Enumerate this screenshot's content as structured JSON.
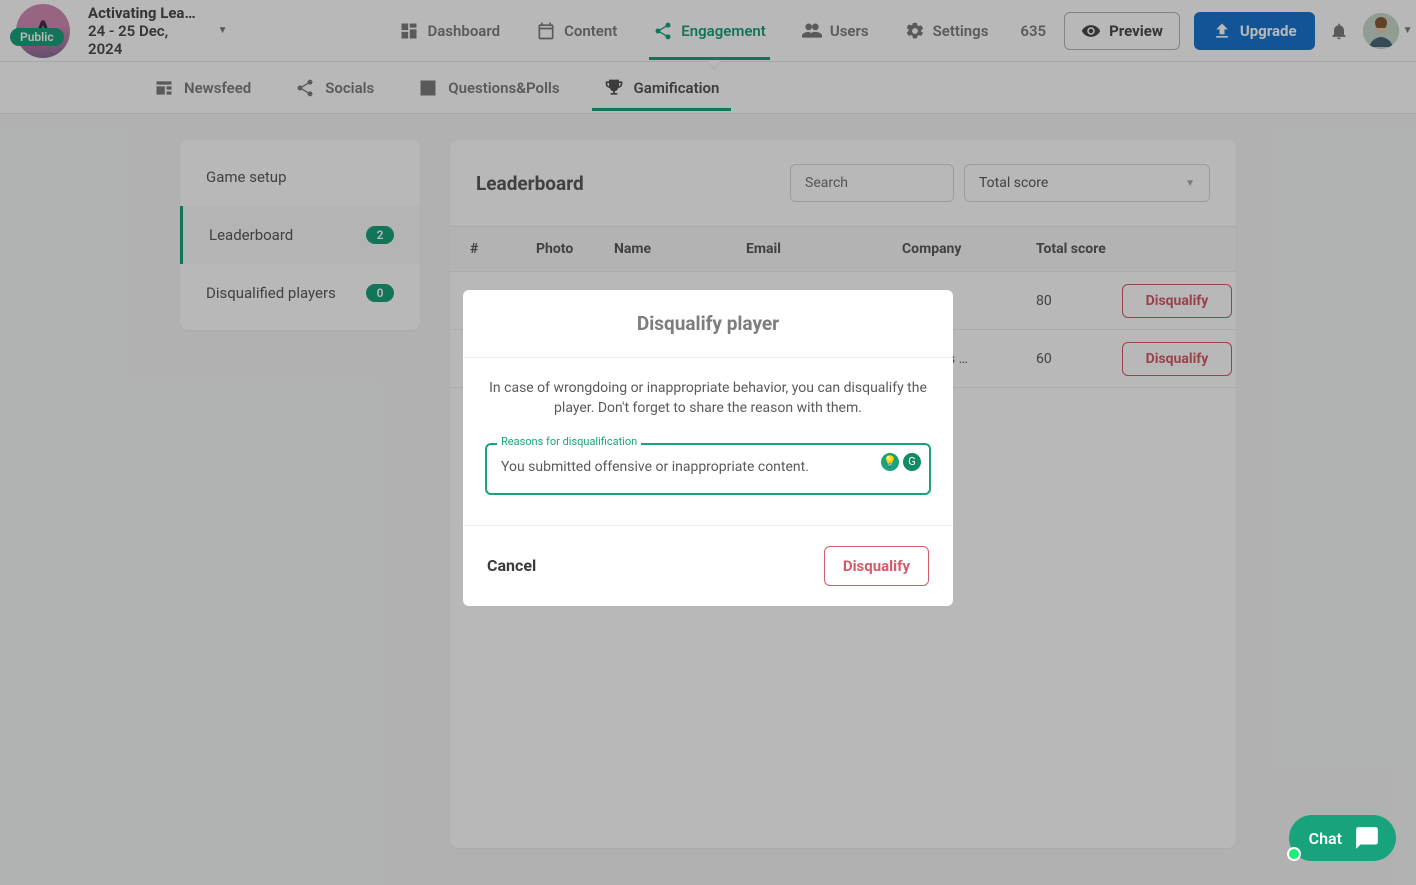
{
  "brand": {
    "initial": "A",
    "badge": "Public",
    "title": "Activating Lea…",
    "dates": "24 - 25 Dec, 2024"
  },
  "nav": {
    "dashboard": "Dashboard",
    "content": "Content",
    "engagement": "Engagement",
    "users": "Users",
    "settings": "Settings",
    "settings_badge": "635",
    "preview": "Preview",
    "upgrade": "Upgrade"
  },
  "subnav": {
    "newsfeed": "Newsfeed",
    "socials": "Socials",
    "qp": "Questions&Polls",
    "gamification": "Gamification"
  },
  "sidebar": {
    "setup": "Game setup",
    "leaderboard": "Leaderboard",
    "leaderboard_count": "2",
    "disqualified": "Disqualified players",
    "disqualified_count": "0"
  },
  "leaderboard": {
    "title": "Leaderboard",
    "search_placeholder": "Search",
    "sort_value": "Total score",
    "columns": {
      "num": "#",
      "photo": "Photo",
      "name": "Name",
      "email": "Email",
      "company": "Company",
      "score": "Total score"
    },
    "rows": [
      {
        "company": "",
        "score": "80",
        "action": "Disqualify"
      },
      {
        "company": "ovations …",
        "score": "60",
        "action": "Disqualify"
      }
    ]
  },
  "modal": {
    "title": "Disqualify player",
    "body": "In case of wrongdoing or inappropriate behavior, you can disqualify the player. Don't forget to share the reason with them.",
    "label": "Reasons for disqualification",
    "value": "You submitted offensive or inappropriate content.",
    "cancel": "Cancel",
    "confirm": "Disqualify"
  },
  "chat": {
    "label": "Chat"
  }
}
